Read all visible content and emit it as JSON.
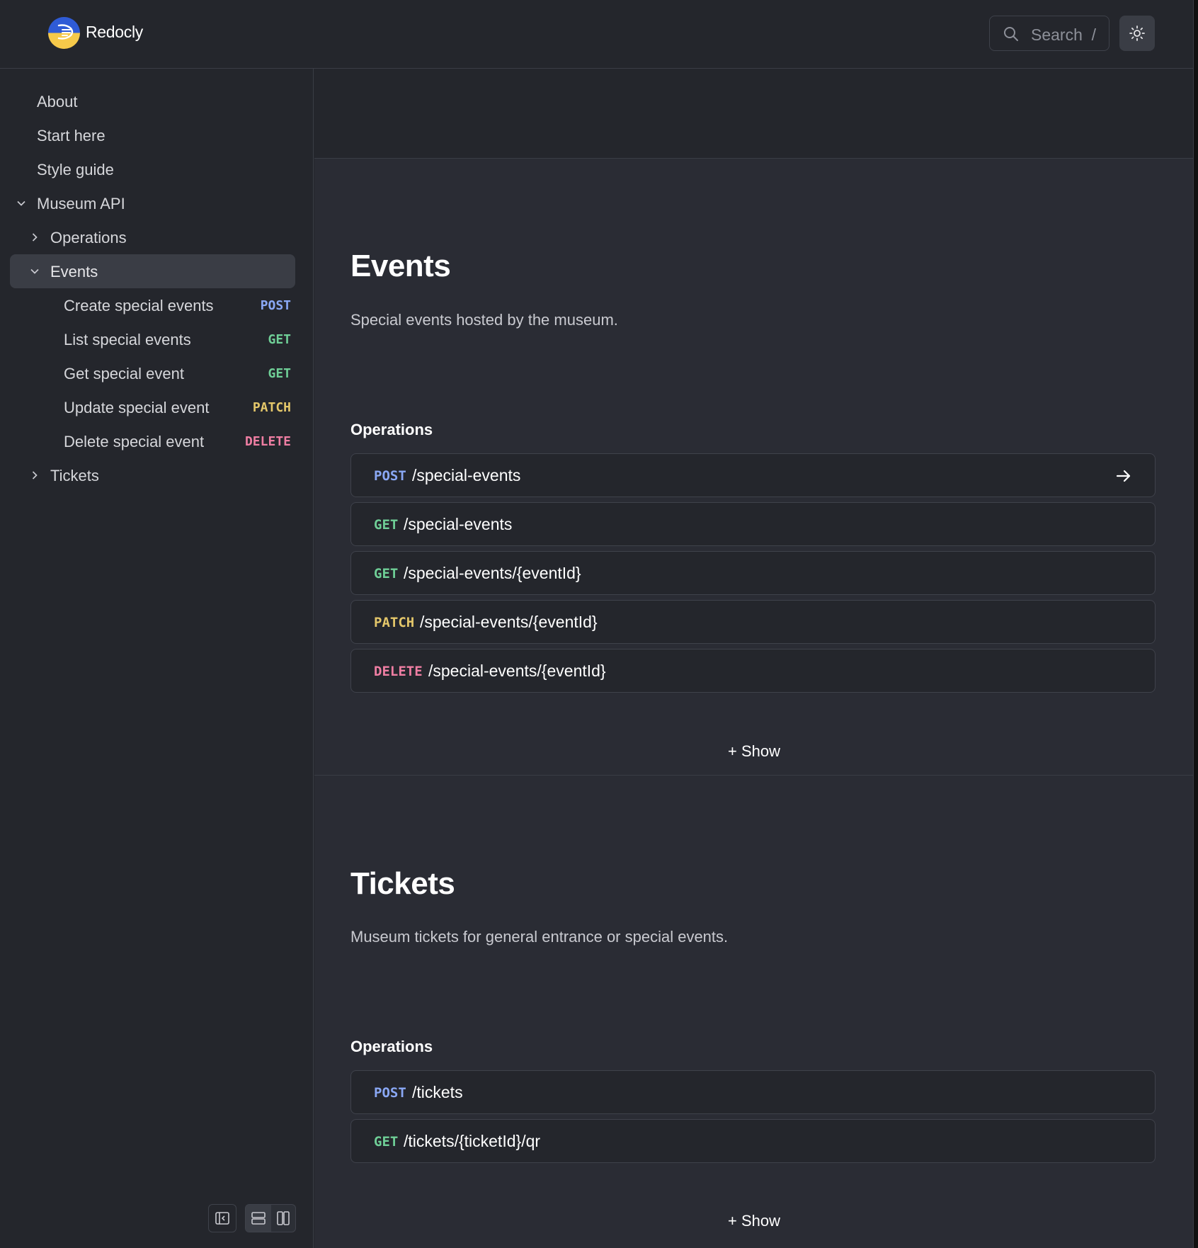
{
  "header": {
    "brand": "Redocly",
    "search_label": "Search",
    "search_shortcut": "/"
  },
  "sidebar": {
    "items": [
      {
        "label": "About"
      },
      {
        "label": "Start here"
      },
      {
        "label": "Style guide"
      },
      {
        "label": "Museum API",
        "expanded": true
      },
      {
        "label": "Operations",
        "expanded": false
      },
      {
        "label": "Events",
        "expanded": true,
        "active": true
      },
      {
        "label": "Create special events",
        "method": "POST"
      },
      {
        "label": "List special events",
        "method": "GET"
      },
      {
        "label": "Get special event",
        "method": "GET"
      },
      {
        "label": "Update special event",
        "method": "PATCH"
      },
      {
        "label": "Delete special event",
        "method": "DELETE"
      },
      {
        "label": "Tickets",
        "expanded": false
      }
    ]
  },
  "events": {
    "title": "Events",
    "description": "Special events hosted by the museum.",
    "operations_title": "Operations",
    "operations": [
      {
        "method": "POST",
        "path": "/special-events"
      },
      {
        "method": "GET",
        "path": "/special-events"
      },
      {
        "method": "GET",
        "path": "/special-events/{eventId}"
      },
      {
        "method": "PATCH",
        "path": "/special-events/{eventId}"
      },
      {
        "method": "DELETE",
        "path": "/special-events/{eventId}"
      }
    ],
    "show_label": "+ Show"
  },
  "tickets": {
    "title": "Tickets",
    "description": "Museum tickets for general entrance or special events.",
    "operations_title": "Operations",
    "operations": [
      {
        "method": "POST",
        "path": "/tickets"
      },
      {
        "method": "GET",
        "path": "/tickets/{ticketId}/qr"
      }
    ],
    "show_label": "+ Show"
  },
  "colors": {
    "POST": "#8aa8f5",
    "GET": "#6fcf97",
    "PATCH": "#e4c76a",
    "DELETE": "#ef7ea3"
  }
}
